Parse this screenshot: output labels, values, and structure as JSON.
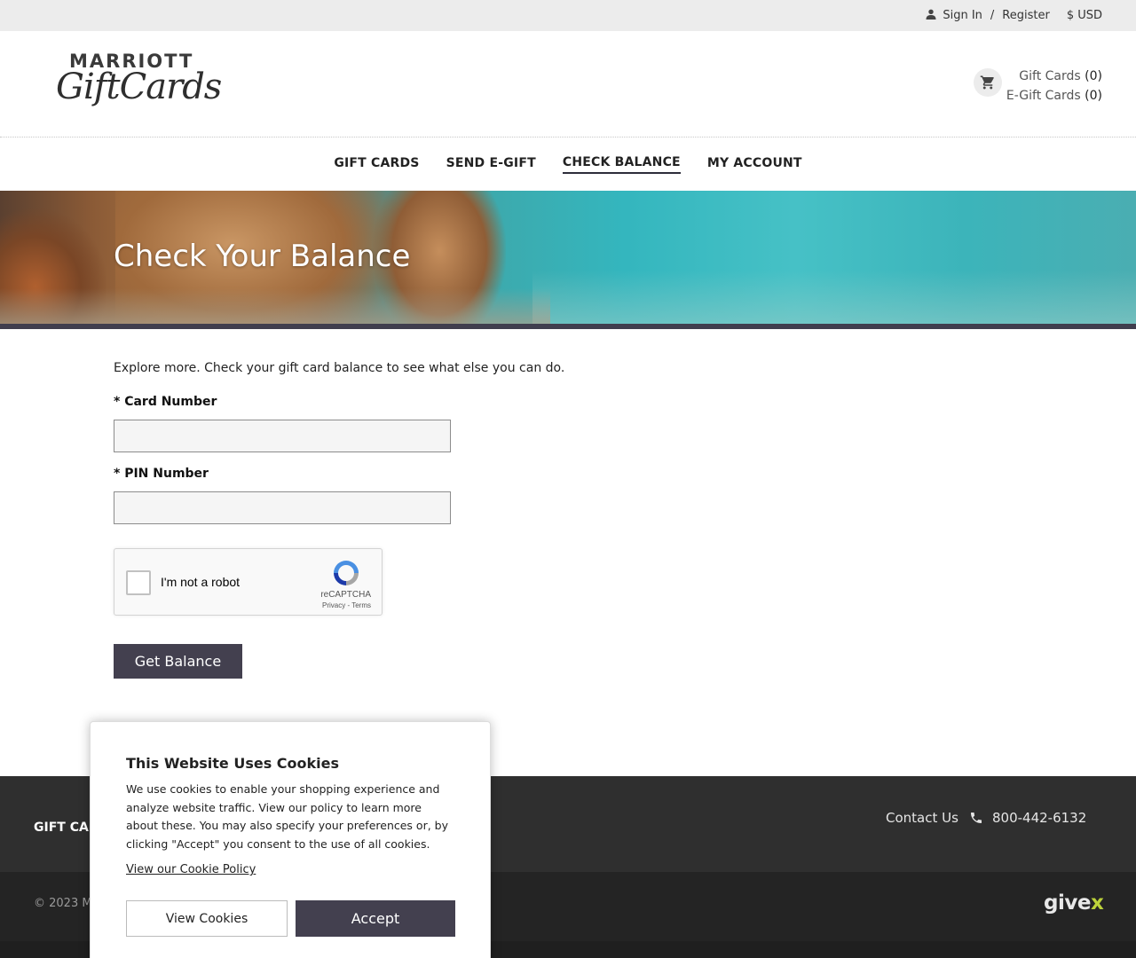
{
  "topbar": {
    "sign_in": "Sign In",
    "separator": "/",
    "register": "Register",
    "currency": "$ USD"
  },
  "header": {
    "logo_brand": "MARRIOTT",
    "logo_script": "GiftCards",
    "cart": {
      "gift_cards_label": "Gift Cards",
      "gift_cards_count": "(0)",
      "egift_cards_label": "E-Gift Cards",
      "egift_cards_count": "(0)"
    }
  },
  "nav": {
    "items": [
      {
        "label": "GIFT CARDS",
        "active": false
      },
      {
        "label": "SEND E-GIFT",
        "active": false
      },
      {
        "label": "CHECK BALANCE",
        "active": true
      },
      {
        "label": "MY ACCOUNT",
        "active": false
      }
    ]
  },
  "hero": {
    "title": "Check Your Balance"
  },
  "form": {
    "intro": "Explore more. Check your gift card balance to see what else you can do.",
    "card_number_label": "* Card Number",
    "card_number_value": "",
    "pin_label": "* PIN Number",
    "pin_value": "",
    "captcha": {
      "checkbox_text": "I'm not a robot",
      "brand": "reCAPTCHA",
      "terms": "Privacy - Terms"
    },
    "submit_label": "Get Balance"
  },
  "footer": {
    "gift_cards": "GIFT CARDS",
    "contact_us": "Contact Us",
    "phone": "800-442-6132",
    "copyright": "© 2023 MI",
    "givex_main": "give",
    "givex_x": "x"
  },
  "cookie_modal": {
    "title": "This Website Uses Cookies",
    "body": "We use cookies to enable your shopping experience and analyze website traffic. View our policy to learn more about these. You may also specify your preferences or, by clicking \"Accept\" you consent to the use of all cookies.",
    "policy_link": "View our Cookie Policy",
    "view_button": "View Cookies",
    "accept_button": "Accept"
  },
  "colors": {
    "topbar_bg": "#ececec",
    "accent_button": "#43404f",
    "hero_band": "#403e4e",
    "footer_top": "#2f2f2f",
    "footer_bottom": "#242424",
    "givex_accent": "#bcd23a"
  }
}
